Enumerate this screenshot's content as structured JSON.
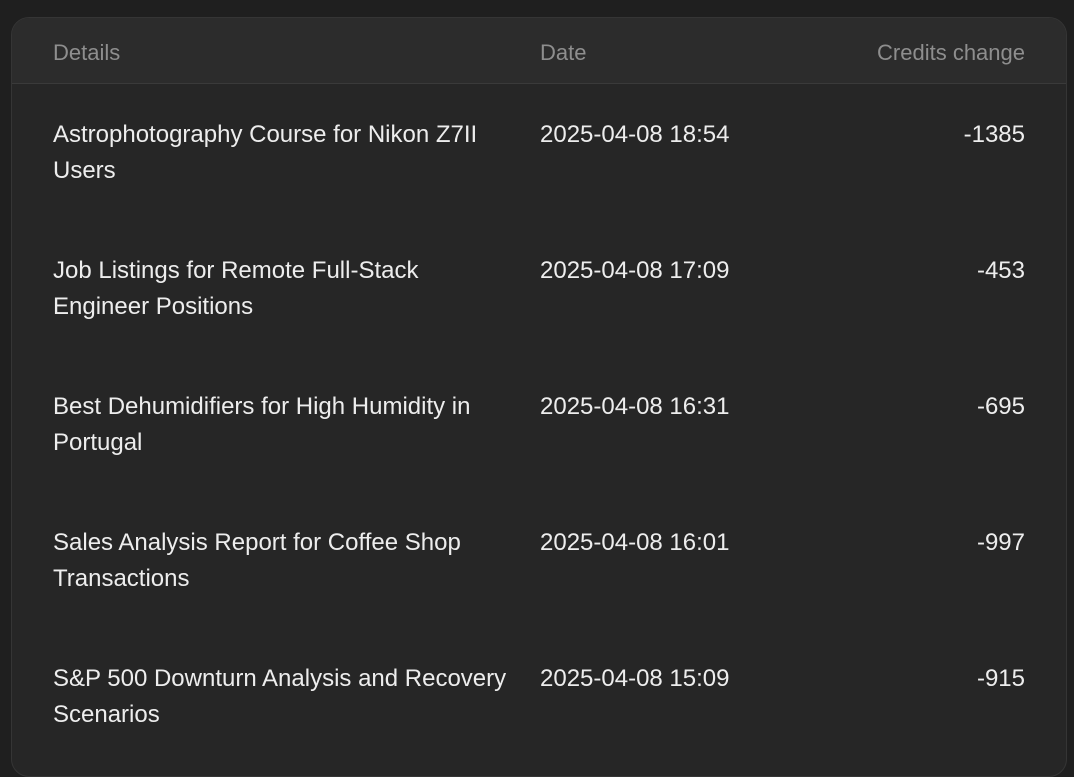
{
  "table": {
    "headers": {
      "details": "Details",
      "date": "Date",
      "credits": "Credits change"
    },
    "rows": [
      {
        "details": "Astrophotography Course for Nikon Z7II Users",
        "date": "2025-04-08 18:54",
        "credits": "-1385"
      },
      {
        "details": "Job Listings for Remote Full-Stack Engineer Positions",
        "date": "2025-04-08 17:09",
        "credits": "-453"
      },
      {
        "details": "Best Dehumidifiers for High Humidity in Portugal",
        "date": "2025-04-08 16:31",
        "credits": "-695"
      },
      {
        "details": "Sales Analysis Report for Coffee Shop Transactions",
        "date": "2025-04-08 16:01",
        "credits": "-997"
      },
      {
        "details": "S&P 500 Downturn Analysis and Recovery Scenarios",
        "date": "2025-04-08 15:09",
        "credits": "-915"
      }
    ]
  },
  "colors": {
    "page_background": "#1f1f1f",
    "panel_background": "#262626",
    "header_background": "#2c2c2c",
    "header_text": "#8e8e8e",
    "row_text": "#ededed"
  }
}
